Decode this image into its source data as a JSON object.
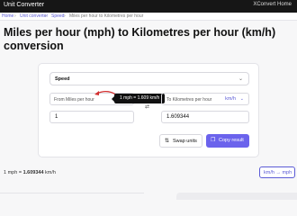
{
  "topbar": {
    "brand": "Unit Converter",
    "home_link": "XConvert Home"
  },
  "breadcrumb": {
    "items": [
      "Home",
      "Unit converter",
      "Speed",
      "Miles per hour to Kilometres per hour"
    ]
  },
  "page_title": "Miles per hour (mph) to Kilometres per hour (km/h) conversion",
  "converter": {
    "category": "Speed",
    "from_label": "From Miles per hour",
    "to_label": "To Kilometres per hour",
    "to_unit": "km/h",
    "tooltip": "1 mph = 1.609 km/h",
    "from_value": "1",
    "to_value": "1.609344",
    "swap_label": "Swap units",
    "copy_label": "Copy result"
  },
  "result": {
    "lhs": "1 mph = ",
    "value": "1.609344",
    "unit": " km/h"
  },
  "reverse_link": "km/h → mph",
  "colors": {
    "accent": "#6b63ec",
    "topbar": "#161616",
    "arrow": "#d32f2f"
  },
  "icons": [
    "chevron-down-icon",
    "swap-icon",
    "copy-icon",
    "arrow-icon"
  ]
}
